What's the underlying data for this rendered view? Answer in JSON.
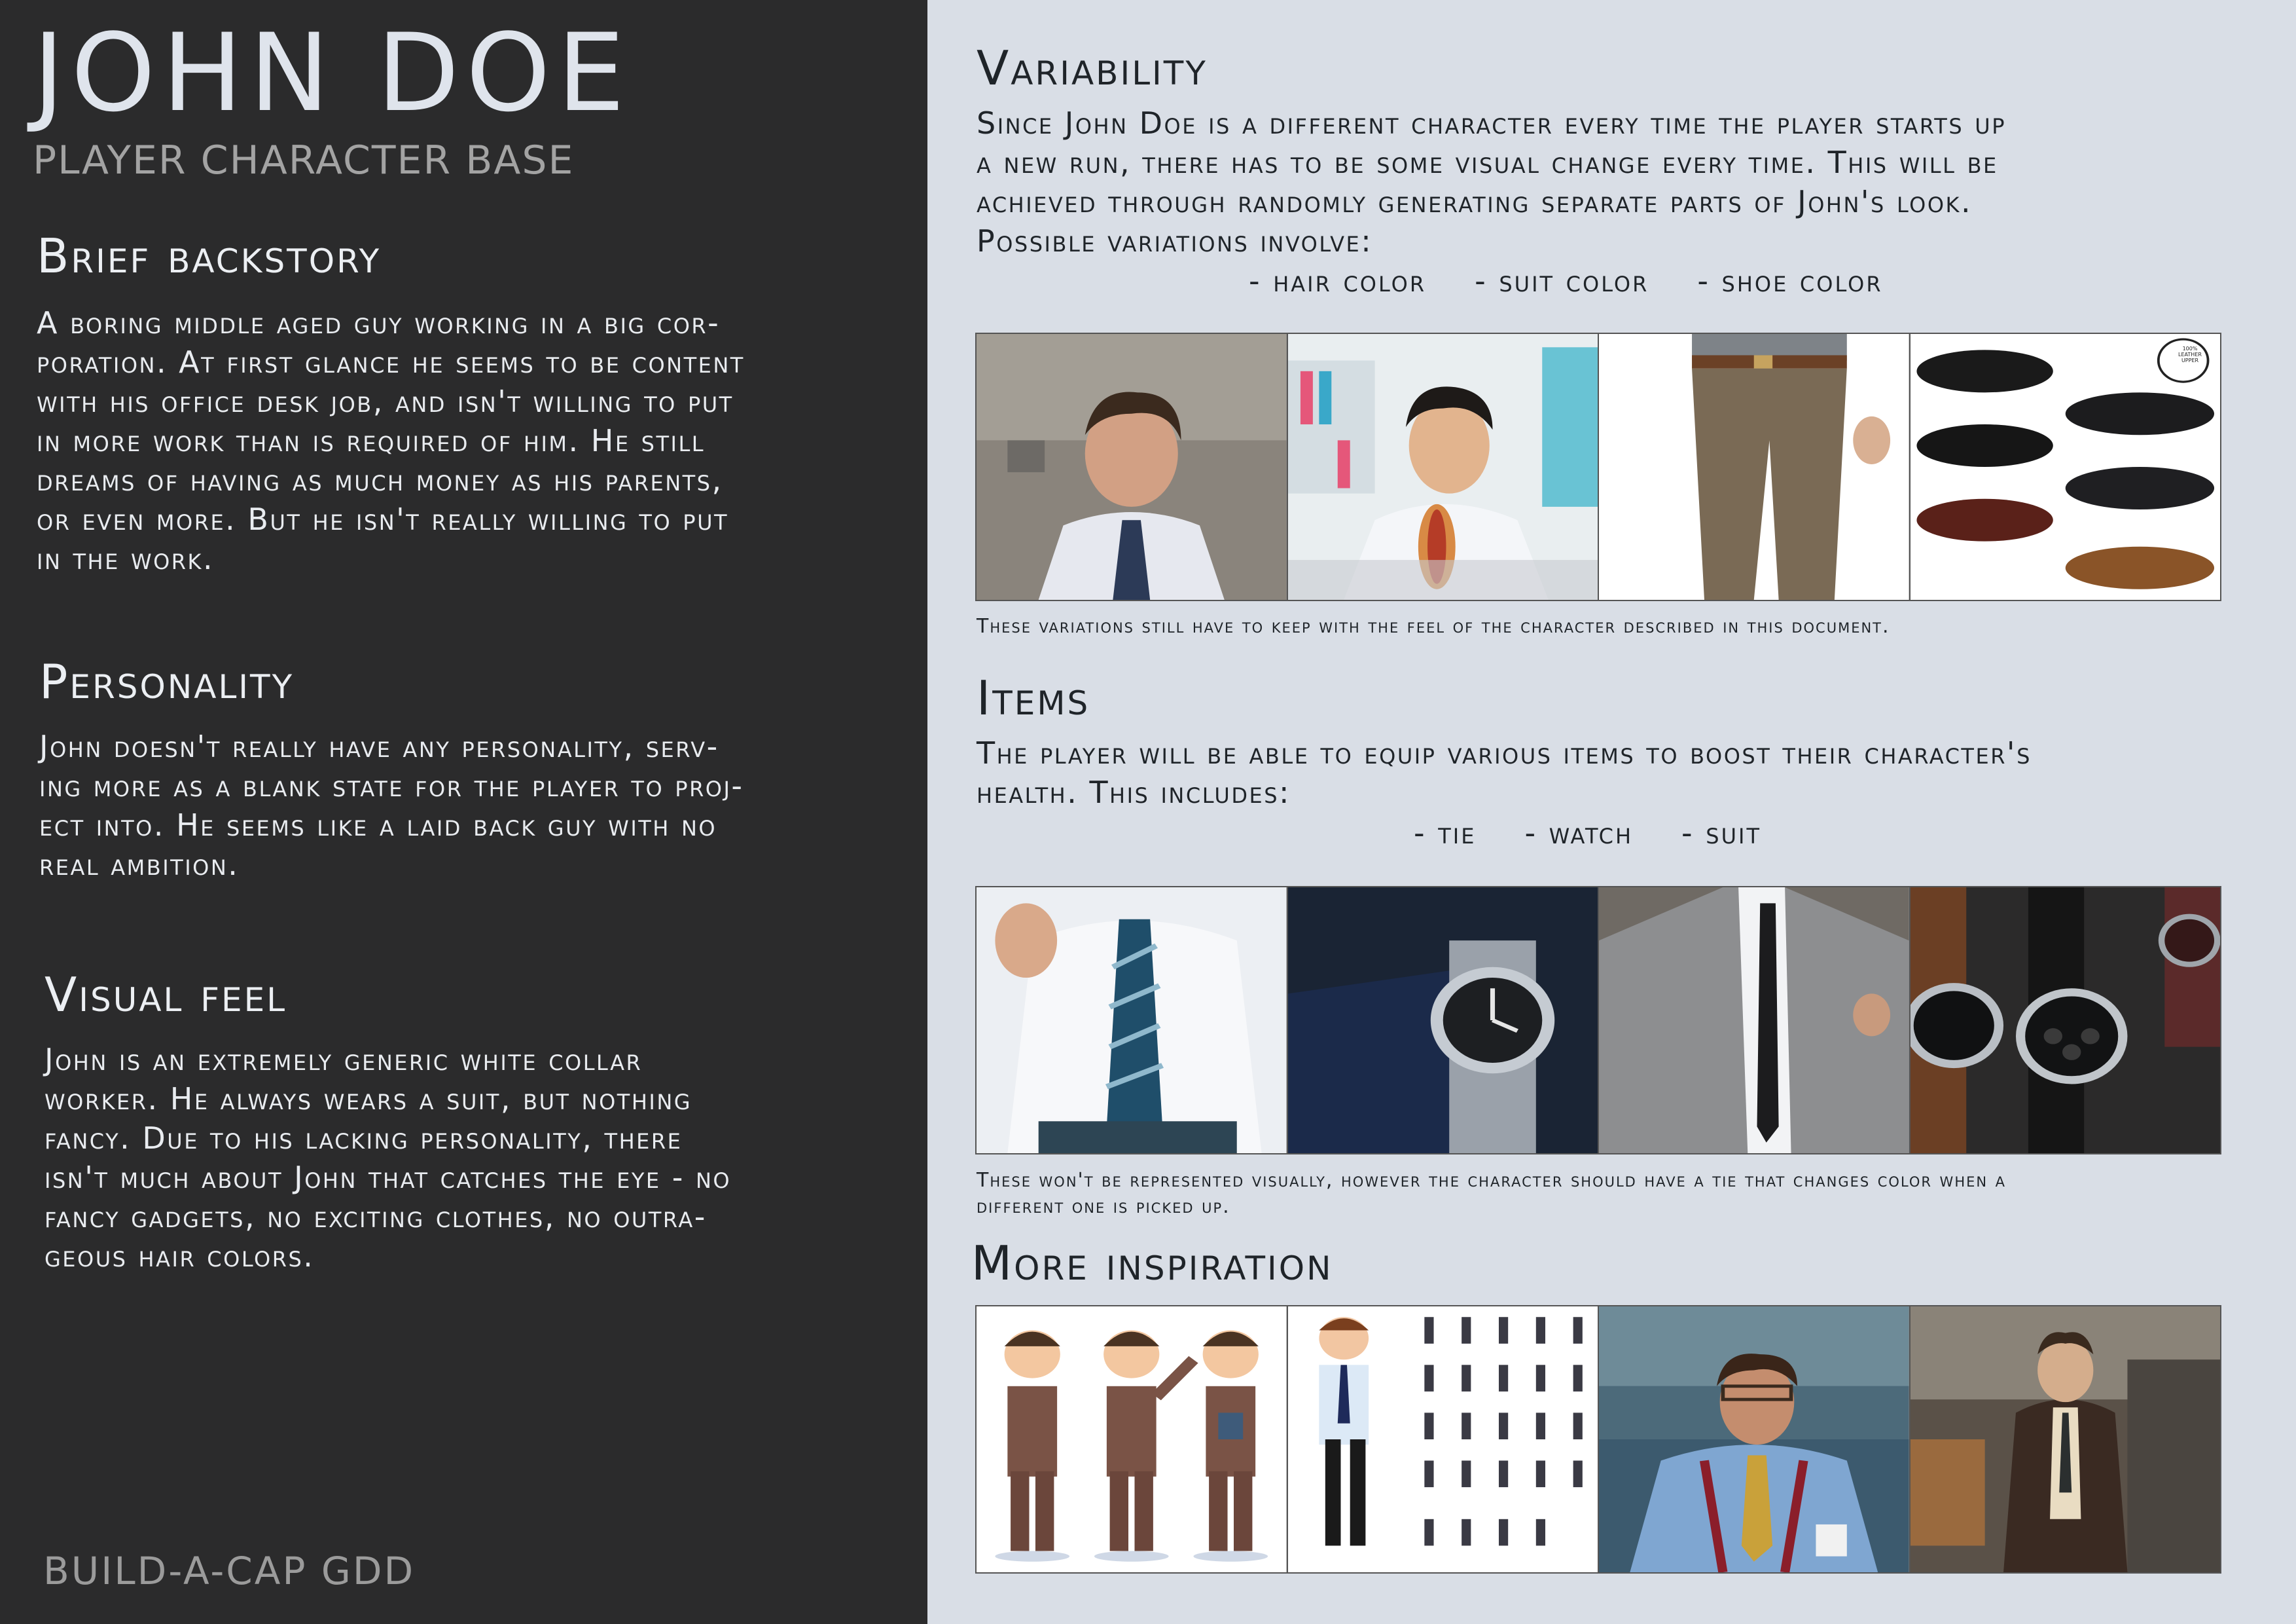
{
  "left": {
    "title": "JOHN DOE",
    "subtitle": "PLAYER CHARACTER BASE",
    "sections": [
      {
        "heading": "Brief backstory",
        "body": "A boring middle aged guy working in a big cor-\nporation. At first glance he seems to be content\nwith his office desk job, and isn't willing to put\nin more work than is required of him. He still\ndreams of having as much money as his parents,\nor even more. But he isn't really willing to put\nin the work."
      },
      {
        "heading": "Personality",
        "body": "John doesn't really have any personality, serv-\ning more as a blank state for the player to proj-\nect into. He seems like a laid back guy with no\nreal ambition."
      },
      {
        "heading": "Visual feel",
        "body": "John is an extremely generic white collar\nworker. He always wears a suit, but nothing\nfancy. Due to his lacking personality, there\nisn't much about John that catches the eye - no\nfancy gadgets, no exciting clothes, no outra-\ngeous hair colors."
      }
    ],
    "footer": "BUILD-A-CAP GDD"
  },
  "right": {
    "variability": {
      "heading": "Variability",
      "body": "Since John Doe is a different character every time the player starts up\na new run, there has to be some visual change every time. This will be\nachieved through randomly generating separate parts of John's look.\nPossible variations involve:",
      "list": [
        "- hair color",
        "- suit color",
        "- shoe color"
      ],
      "caption": "These variations still have to keep with the feel of the character described in this document.",
      "badge_text": [
        "100%",
        "LEATHER",
        "UPPER"
      ]
    },
    "items": {
      "heading": "Items",
      "body": "The player will be able to equip various items to boost their character's\nhealth. This includes:",
      "list": [
        "- tie",
        "- watch",
        "- suit"
      ],
      "caption": "These won't be represented visually, however the character should have a tie that changes color when a\ndifferent one is picked up."
    },
    "inspiration": {
      "heading": "More inspiration"
    }
  },
  "colors": {
    "left_bg": "#2b2b2c",
    "right_bg": "#d9dee6",
    "title": "#dfe4ec",
    "subtitle": "#a3a3a3",
    "dark_text": "#1f2429"
  },
  "photos": {
    "variability": [
      "office-man-portrait-photo",
      "man-eating-hotdog-photo",
      "brown-trousers-photo",
      "dress-shoes-photo"
    ],
    "items": [
      "tie-photo",
      "wristwatch-photo",
      "grey-suit-photo",
      "chronograph-watches-photo"
    ],
    "inspiration": [
      "cartoon-businessman-poses-image",
      "cartoon-office-worker-sprites-image",
      "man-with-suspenders-photo",
      "man-in-brown-suit-photo"
    ]
  }
}
